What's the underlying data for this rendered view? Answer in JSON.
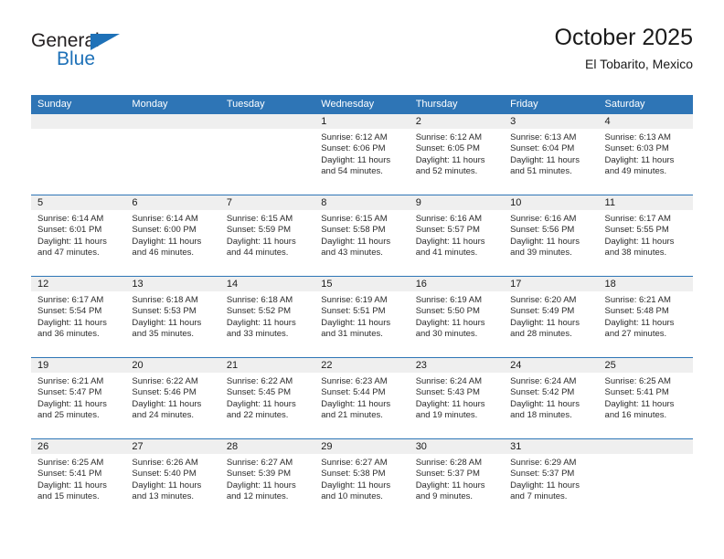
{
  "brand": {
    "name_part1": "General",
    "name_part2": "Blue",
    "triangle_icon": "triangle-icon",
    "colors": {
      "blue": "#1e71b8",
      "dark": "#231f20"
    }
  },
  "header": {
    "title": "October 2025",
    "subtitle": "El Tobarito, Mexico"
  },
  "theme": {
    "header_blue": "#2e75b6",
    "date_strip_gray": "#efefef",
    "divider_blue": "#2e75b6"
  },
  "calendar": {
    "weekdays": [
      "Sunday",
      "Monday",
      "Tuesday",
      "Wednesday",
      "Thursday",
      "Friday",
      "Saturday"
    ],
    "weeks": [
      [
        {
          "day": "",
          "empty": true
        },
        {
          "day": "",
          "empty": true
        },
        {
          "day": "",
          "empty": true
        },
        {
          "day": "1",
          "sunrise": "Sunrise: 6:12 AM",
          "sunset": "Sunset: 6:06 PM",
          "daylight": "Daylight: 11 hours and 54 minutes."
        },
        {
          "day": "2",
          "sunrise": "Sunrise: 6:12 AM",
          "sunset": "Sunset: 6:05 PM",
          "daylight": "Daylight: 11 hours and 52 minutes."
        },
        {
          "day": "3",
          "sunrise": "Sunrise: 6:13 AM",
          "sunset": "Sunset: 6:04 PM",
          "daylight": "Daylight: 11 hours and 51 minutes."
        },
        {
          "day": "4",
          "sunrise": "Sunrise: 6:13 AM",
          "sunset": "Sunset: 6:03 PM",
          "daylight": "Daylight: 11 hours and 49 minutes."
        }
      ],
      [
        {
          "day": "5",
          "sunrise": "Sunrise: 6:14 AM",
          "sunset": "Sunset: 6:01 PM",
          "daylight": "Daylight: 11 hours and 47 minutes."
        },
        {
          "day": "6",
          "sunrise": "Sunrise: 6:14 AM",
          "sunset": "Sunset: 6:00 PM",
          "daylight": "Daylight: 11 hours and 46 minutes."
        },
        {
          "day": "7",
          "sunrise": "Sunrise: 6:15 AM",
          "sunset": "Sunset: 5:59 PM",
          "daylight": "Daylight: 11 hours and 44 minutes."
        },
        {
          "day": "8",
          "sunrise": "Sunrise: 6:15 AM",
          "sunset": "Sunset: 5:58 PM",
          "daylight": "Daylight: 11 hours and 43 minutes."
        },
        {
          "day": "9",
          "sunrise": "Sunrise: 6:16 AM",
          "sunset": "Sunset: 5:57 PM",
          "daylight": "Daylight: 11 hours and 41 minutes."
        },
        {
          "day": "10",
          "sunrise": "Sunrise: 6:16 AM",
          "sunset": "Sunset: 5:56 PM",
          "daylight": "Daylight: 11 hours and 39 minutes."
        },
        {
          "day": "11",
          "sunrise": "Sunrise: 6:17 AM",
          "sunset": "Sunset: 5:55 PM",
          "daylight": "Daylight: 11 hours and 38 minutes."
        }
      ],
      [
        {
          "day": "12",
          "sunrise": "Sunrise: 6:17 AM",
          "sunset": "Sunset: 5:54 PM",
          "daylight": "Daylight: 11 hours and 36 minutes."
        },
        {
          "day": "13",
          "sunrise": "Sunrise: 6:18 AM",
          "sunset": "Sunset: 5:53 PM",
          "daylight": "Daylight: 11 hours and 35 minutes."
        },
        {
          "day": "14",
          "sunrise": "Sunrise: 6:18 AM",
          "sunset": "Sunset: 5:52 PM",
          "daylight": "Daylight: 11 hours and 33 minutes."
        },
        {
          "day": "15",
          "sunrise": "Sunrise: 6:19 AM",
          "sunset": "Sunset: 5:51 PM",
          "daylight": "Daylight: 11 hours and 31 minutes."
        },
        {
          "day": "16",
          "sunrise": "Sunrise: 6:19 AM",
          "sunset": "Sunset: 5:50 PM",
          "daylight": "Daylight: 11 hours and 30 minutes."
        },
        {
          "day": "17",
          "sunrise": "Sunrise: 6:20 AM",
          "sunset": "Sunset: 5:49 PM",
          "daylight": "Daylight: 11 hours and 28 minutes."
        },
        {
          "day": "18",
          "sunrise": "Sunrise: 6:21 AM",
          "sunset": "Sunset: 5:48 PM",
          "daylight": "Daylight: 11 hours and 27 minutes."
        }
      ],
      [
        {
          "day": "19",
          "sunrise": "Sunrise: 6:21 AM",
          "sunset": "Sunset: 5:47 PM",
          "daylight": "Daylight: 11 hours and 25 minutes."
        },
        {
          "day": "20",
          "sunrise": "Sunrise: 6:22 AM",
          "sunset": "Sunset: 5:46 PM",
          "daylight": "Daylight: 11 hours and 24 minutes."
        },
        {
          "day": "21",
          "sunrise": "Sunrise: 6:22 AM",
          "sunset": "Sunset: 5:45 PM",
          "daylight": "Daylight: 11 hours and 22 minutes."
        },
        {
          "day": "22",
          "sunrise": "Sunrise: 6:23 AM",
          "sunset": "Sunset: 5:44 PM",
          "daylight": "Daylight: 11 hours and 21 minutes."
        },
        {
          "day": "23",
          "sunrise": "Sunrise: 6:24 AM",
          "sunset": "Sunset: 5:43 PM",
          "daylight": "Daylight: 11 hours and 19 minutes."
        },
        {
          "day": "24",
          "sunrise": "Sunrise: 6:24 AM",
          "sunset": "Sunset: 5:42 PM",
          "daylight": "Daylight: 11 hours and 18 minutes."
        },
        {
          "day": "25",
          "sunrise": "Sunrise: 6:25 AM",
          "sunset": "Sunset: 5:41 PM",
          "daylight": "Daylight: 11 hours and 16 minutes."
        }
      ],
      [
        {
          "day": "26",
          "sunrise": "Sunrise: 6:25 AM",
          "sunset": "Sunset: 5:41 PM",
          "daylight": "Daylight: 11 hours and 15 minutes."
        },
        {
          "day": "27",
          "sunrise": "Sunrise: 6:26 AM",
          "sunset": "Sunset: 5:40 PM",
          "daylight": "Daylight: 11 hours and 13 minutes."
        },
        {
          "day": "28",
          "sunrise": "Sunrise: 6:27 AM",
          "sunset": "Sunset: 5:39 PM",
          "daylight": "Daylight: 11 hours and 12 minutes."
        },
        {
          "day": "29",
          "sunrise": "Sunrise: 6:27 AM",
          "sunset": "Sunset: 5:38 PM",
          "daylight": "Daylight: 11 hours and 10 minutes."
        },
        {
          "day": "30",
          "sunrise": "Sunrise: 6:28 AM",
          "sunset": "Sunset: 5:37 PM",
          "daylight": "Daylight: 11 hours and 9 minutes."
        },
        {
          "day": "31",
          "sunrise": "Sunrise: 6:29 AM",
          "sunset": "Sunset: 5:37 PM",
          "daylight": "Daylight: 11 hours and 7 minutes."
        },
        {
          "day": "",
          "empty": true
        }
      ]
    ]
  }
}
